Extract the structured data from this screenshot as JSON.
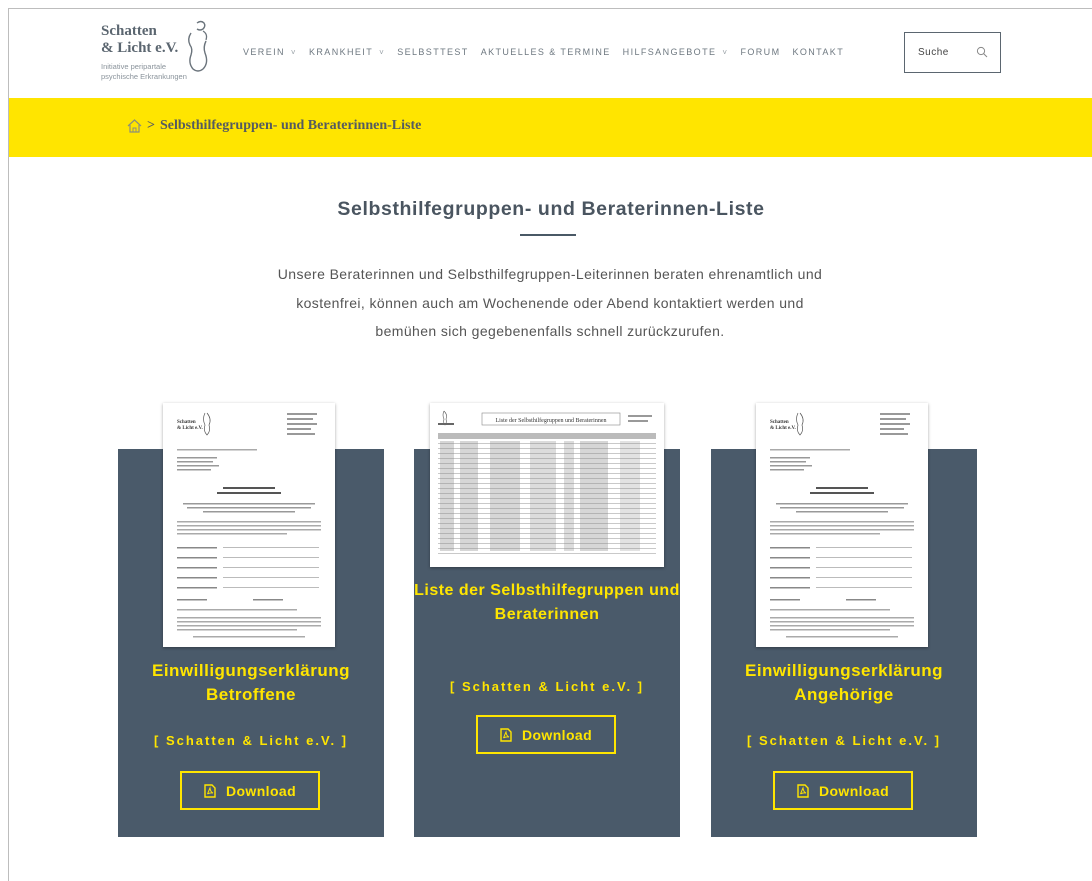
{
  "logo": {
    "line1": "Schatten",
    "line2": "& Licht e.V.",
    "sub1": "Initiative peripartale",
    "sub2": "psychische Erkrankungen"
  },
  "nav": {
    "items": [
      {
        "label": "VEREIN",
        "has_dropdown": true
      },
      {
        "label": "KRANKHEIT",
        "has_dropdown": true
      },
      {
        "label": "SELBSTTEST",
        "has_dropdown": false
      },
      {
        "label": "AKTUELLES & TERMINE",
        "has_dropdown": false
      },
      {
        "label": "HILFSANGEBOTE",
        "has_dropdown": true
      },
      {
        "label": "FORUM",
        "has_dropdown": false
      },
      {
        "label": "KONTAKT",
        "has_dropdown": false
      }
    ],
    "dropdown_caret": "˅"
  },
  "search": {
    "placeholder": "Suche",
    "icon": "search-icon"
  },
  "breadcrumb": {
    "separator": ">",
    "current": "Selbsthilfegruppen- und Beraterinnen-Liste",
    "icon": "home-icon"
  },
  "main": {
    "title": "Selbsthilfegruppen- und Beraterinnen-Liste",
    "intro": "Unsere Beraterinnen und Selbsthilfegruppen-Leiterinnen beraten ehrenamtlich und kostenfrei, können auch am Wochenende oder Abend kontaktiert werden und bemühen sich gegebenenfalls schnell zurückzurufen."
  },
  "cards": [
    {
      "title": "Einwilligungserklärung Betroffene",
      "subtitle": "[ Schatten & Licht e.V. ]",
      "button": "Download"
    },
    {
      "title": "Liste der Selbsthilfegruppen und Beraterinnen",
      "subtitle": "[ Schatten & Licht e.V. ]",
      "button": "Download"
    },
    {
      "title": "Einwilligungserklärung Angehörige",
      "subtitle": "[ Schatten & Licht e.V. ]",
      "button": "Download"
    }
  ],
  "colors": {
    "accent_yellow": "#ffe500",
    "card_bg": "#4a5a6a",
    "text_dark": "#4a5560"
  }
}
